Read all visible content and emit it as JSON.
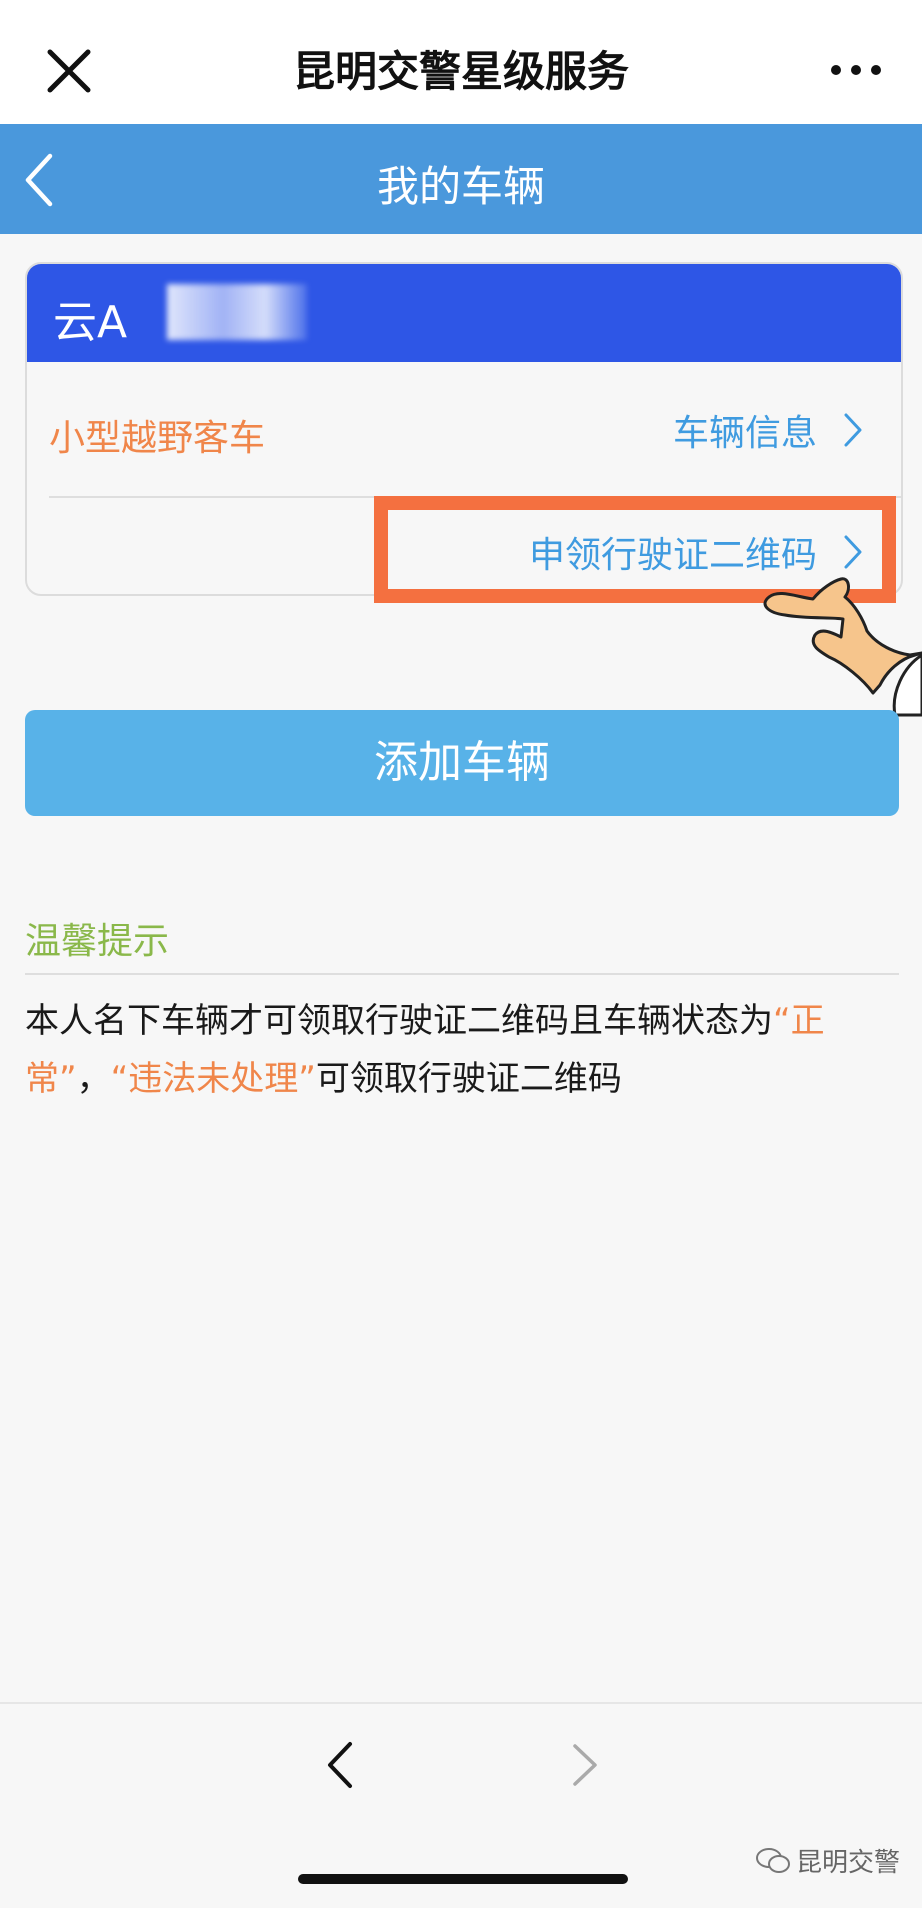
{
  "topbar": {
    "title": "昆明交警星级服务"
  },
  "navbar": {
    "title": "我的车辆"
  },
  "card": {
    "plate": "云A",
    "vehicle_type": "小型越野客车",
    "vehicle_info": "车辆信息",
    "qr_apply": "申领行驶证二维码"
  },
  "add_button": "添加车辆",
  "tip": {
    "title": "温馨提示",
    "text_1": "本人名下车辆才可领取行驶证二维码且车辆状态为",
    "quote_1": "“正常”",
    "sep": "，",
    "quote_2": "“违法未处理”",
    "text_2": "可领取行驶证二维码"
  },
  "watermark": "昆明交警",
  "colors": {
    "navbar": "#4a98dc",
    "card_head": "#2e56e6",
    "accent_orange": "#f0864a",
    "link_blue": "#3f9be0",
    "button": "#58b2e8",
    "tip_green": "#8ab84a",
    "highlight": "#f47040"
  },
  "icons": [
    "close-icon",
    "more-icon",
    "back-chevron-icon",
    "chevron-right-icon",
    "pointing-hand-icon",
    "wechat-icon"
  ]
}
